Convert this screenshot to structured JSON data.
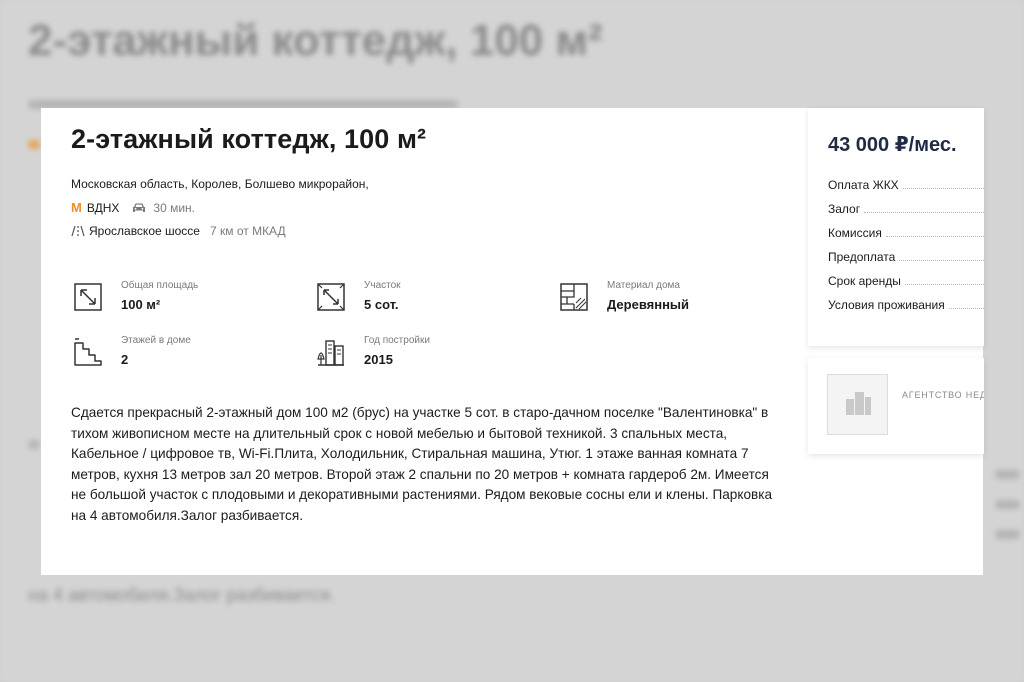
{
  "background": {
    "title": "2-этажный коттедж, 100 м²",
    "trailing_text": "на 4 автомобиля.Залог разбивается."
  },
  "listing": {
    "title": "2-этажный коттедж, 100 м²",
    "address": "Московская область, Королев, Болшево микрорайон,",
    "metro": {
      "icon": "metro-m-icon",
      "letter": "M",
      "station": "ВДНХ",
      "travel_icon": "car-icon",
      "travel_time": "30 мин."
    },
    "highway": {
      "icon": "road-icon",
      "name": "Ярославское шоссе",
      "distance": "7 км от МКАД"
    },
    "features": [
      {
        "icon": "area-arrow-icon",
        "label": "Общая площадь",
        "value": "100 м²"
      },
      {
        "icon": "plot-area-icon",
        "label": "Участок",
        "value": "5 сот."
      },
      {
        "icon": "brick-wall-icon",
        "label": "Материал дома",
        "value": "Деревянный"
      },
      {
        "icon": "stairs-icon",
        "label": "Этажей в доме",
        "value": "2"
      },
      {
        "icon": "buildings-icon",
        "label": "Год постройки",
        "value": "2015"
      }
    ],
    "description": "Сдается прекрасный 2-этажный дом 100 м2 (брус) на участке 5 сот. в старо-дачном поселке \"Валентиновка\" в тихом живописном месте на длительный срок с новой мебелью и бытовой техникой. 3 спальных места, Кабельное / цифровое тв, Wi-Fi.Плита, Холодильник, Стиральная машина, Утюг. 1 этаже ванная комната 7 метров, кухня 13 метров зал 20 метров. Второй этаж 2 спальни по 20 метров + комната гардероб 2м. Имеется не большой участок с плодовыми и декоративными растениями. Рядом вековые сосны ели и клены. Парковка на 4 автомобиля.Залог разбивается."
  },
  "price_panel": {
    "price": "43 000 ₽/мес.",
    "rows": [
      "Оплата ЖКХ",
      "Залог",
      "Комиссия",
      "Предоплата",
      "Срок аренды",
      "Условия проживания"
    ]
  },
  "agency_panel": {
    "logo_icon": "building-placeholder-icon",
    "name": "АГЕНТСТВО НЕД"
  },
  "colors": {
    "metro_accent": "#ef8c2a",
    "price_text": "#1f2a44",
    "icon_stroke": "#333333"
  }
}
